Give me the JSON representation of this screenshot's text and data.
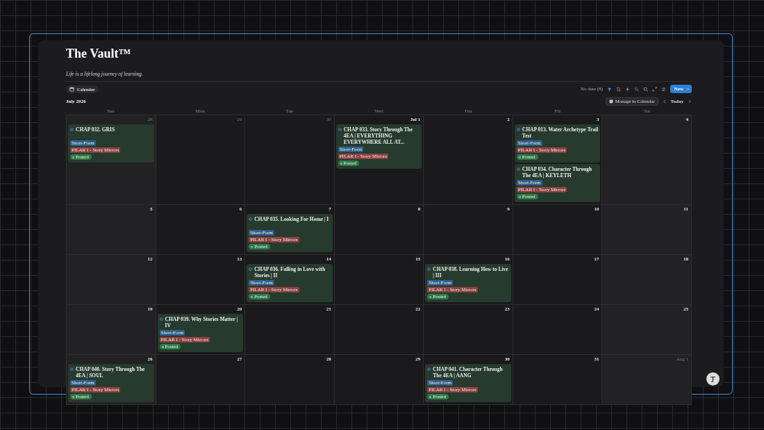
{
  "page": {
    "title": "The Vault™",
    "subtitle": "Life is a lifelong journey of learning."
  },
  "view_tab": {
    "label": "Calendar",
    "selected": true
  },
  "toolbar": {
    "no_date": "No date (8)",
    "filter_active": true,
    "new_button": "New"
  },
  "calendar": {
    "month": "July 2026",
    "manage_button": "Manage in Calendar",
    "today_button": "Today",
    "weekdays": [
      "Sun",
      "Mon",
      "Tue",
      "Wed",
      "Thu",
      "Fri",
      "Sat"
    ],
    "weeks": [
      {
        "days": [
          {
            "label": "28",
            "in_month": false,
            "events": [
              {
                "title": "CHAP 032. GRIS",
                "tags": [
                  {
                    "label": "Short-Form",
                    "kind": "tag",
                    "color": "#2f5f8a"
                  },
                  {
                    "label": "PILAR I - Story Mirrors",
                    "kind": "tag",
                    "color": "#8a4240"
                  },
                  {
                    "label": "Posted",
                    "kind": "status",
                    "color": "#2f7a48"
                  }
                ]
              }
            ]
          },
          {
            "label": "29",
            "in_month": false
          },
          {
            "label": "30",
            "in_month": false
          },
          {
            "label": "Jul 1",
            "in_month": true,
            "events": [
              {
                "title": "CHAP 033. Story Through The 4EA | EVERYTHING EVERYWHERE ALL AT...",
                "tags": [
                  {
                    "label": "Short-Form",
                    "kind": "tag",
                    "color": "#2f5f8a"
                  },
                  {
                    "label": "PILAR I - Story Mirrors",
                    "kind": "tag",
                    "color": "#8a4240"
                  },
                  {
                    "label": "Posted",
                    "kind": "status",
                    "color": "#2f7a48"
                  }
                ]
              }
            ]
          },
          {
            "label": "2",
            "in_month": true
          },
          {
            "label": "3",
            "in_month": true,
            "events": [
              {
                "title": "CHAP 013. Water Archetype Trail Test",
                "tags": [
                  {
                    "label": "Short-Form",
                    "kind": "tag",
                    "color": "#2f5f8a"
                  },
                  {
                    "label": "PILAR I - Story Mirrors",
                    "kind": "tag",
                    "color": "#8a4240"
                  },
                  {
                    "label": "Posted",
                    "kind": "status",
                    "color": "#2f7a48"
                  }
                ]
              },
              {
                "title": "CHAP 034. Character Through The 4EA | KEYLETH",
                "tags": [
                  {
                    "label": "Short-Form",
                    "kind": "tag",
                    "color": "#2f5f8a"
                  },
                  {
                    "label": "PILAR I - Story Mirrors",
                    "kind": "tag",
                    "color": "#8a4240"
                  },
                  {
                    "label": "Posted",
                    "kind": "status",
                    "color": "#2f7a48"
                  }
                ]
              }
            ]
          },
          {
            "label": "4",
            "in_month": true
          }
        ]
      },
      {
        "days": [
          {
            "label": "5",
            "in_month": true
          },
          {
            "label": "6",
            "in_month": true
          },
          {
            "label": "7",
            "in_month": true,
            "events": [
              {
                "title": "CHAP 035. Looking For Home | I",
                "tags": [
                  {
                    "label": "Short-Form",
                    "kind": "tag",
                    "color": "#2f5f8a"
                  },
                  {
                    "label": "PILAR I - Story Mirrors",
                    "kind": "tag",
                    "color": "#8a4240"
                  },
                  {
                    "label": "Posted",
                    "kind": "status",
                    "color": "#2f7a48"
                  }
                ]
              }
            ]
          },
          {
            "label": "8",
            "in_month": true
          },
          {
            "label": "9",
            "in_month": true
          },
          {
            "label": "10",
            "in_month": true
          },
          {
            "label": "11",
            "in_month": true
          }
        ]
      },
      {
        "days": [
          {
            "label": "12",
            "in_month": true
          },
          {
            "label": "13",
            "in_month": true
          },
          {
            "label": "14",
            "in_month": true,
            "events": [
              {
                "title": "CHAP 036. Falling in Love with Stories | II",
                "tags": [
                  {
                    "label": "Short-Form",
                    "kind": "tag",
                    "color": "#2f5f8a"
                  },
                  {
                    "label": "PILAR I - Story Mirrors",
                    "kind": "tag",
                    "color": "#8a4240"
                  },
                  {
                    "label": "Posted",
                    "kind": "status",
                    "color": "#2f7a48"
                  }
                ]
              }
            ]
          },
          {
            "label": "15",
            "in_month": true
          },
          {
            "label": "16",
            "in_month": true,
            "events": [
              {
                "title": "CHAP 038. Learning How to Live |  III",
                "tags": [
                  {
                    "label": "Short-Form",
                    "kind": "tag",
                    "color": "#2f5f8a"
                  },
                  {
                    "label": "PILAR I - Story Mirrors",
                    "kind": "tag",
                    "color": "#8a4240"
                  },
                  {
                    "label": "Posted",
                    "kind": "status",
                    "color": "#2f7a48"
                  }
                ]
              }
            ]
          },
          {
            "label": "17",
            "in_month": true
          },
          {
            "label": "18",
            "in_month": true
          }
        ]
      },
      {
        "days": [
          {
            "label": "19",
            "in_month": true
          },
          {
            "label": "20",
            "in_month": true,
            "events": [
              {
                "title": "CHAP 039. Why Stories Matter |  IV",
                "tags": [
                  {
                    "label": "Short-Form",
                    "kind": "tag",
                    "color": "#2f5f8a"
                  },
                  {
                    "label": "PILAR I - Story Mirrors",
                    "kind": "tag",
                    "color": "#8a4240"
                  },
                  {
                    "label": "Posted",
                    "kind": "status",
                    "color": "#2f7a48"
                  }
                ]
              }
            ]
          },
          {
            "label": "21",
            "in_month": true
          },
          {
            "label": "22",
            "in_month": true
          },
          {
            "label": "23",
            "in_month": true
          },
          {
            "label": "24",
            "in_month": true
          },
          {
            "label": "25",
            "in_month": true
          }
        ]
      },
      {
        "days": [
          {
            "label": "26",
            "in_month": true,
            "events": [
              {
                "title": "CHAP 040. Story Through The 4EA | SOUL",
                "tags": [
                  {
                    "label": "Short-Form",
                    "kind": "tag",
                    "color": "#2f5f8a"
                  },
                  {
                    "label": "PILAR I - Story Mirrors",
                    "kind": "tag",
                    "color": "#8a4240"
                  },
                  {
                    "label": "Posted",
                    "kind": "status",
                    "color": "#2f7a48"
                  }
                ]
              }
            ]
          },
          {
            "label": "27",
            "in_month": true
          },
          {
            "label": "28",
            "in_month": true
          },
          {
            "label": "29",
            "in_month": true
          },
          {
            "label": "30",
            "in_month": true,
            "events": [
              {
                "title": "CHAP 041. Character Through The 4EA | AANG",
                "tags": [
                  {
                    "label": "Short-Form",
                    "kind": "tag",
                    "color": "#2f5f8a"
                  },
                  {
                    "label": "PILAR I - Story Mirrors",
                    "kind": "tag",
                    "color": "#8a4240"
                  },
                  {
                    "label": "Posted",
                    "kind": "status",
                    "color": "#2f7a48"
                  }
                ]
              }
            ]
          },
          {
            "label": "31",
            "in_month": true
          },
          {
            "label": "Aug 1",
            "in_month": false
          }
        ]
      }
    ]
  }
}
